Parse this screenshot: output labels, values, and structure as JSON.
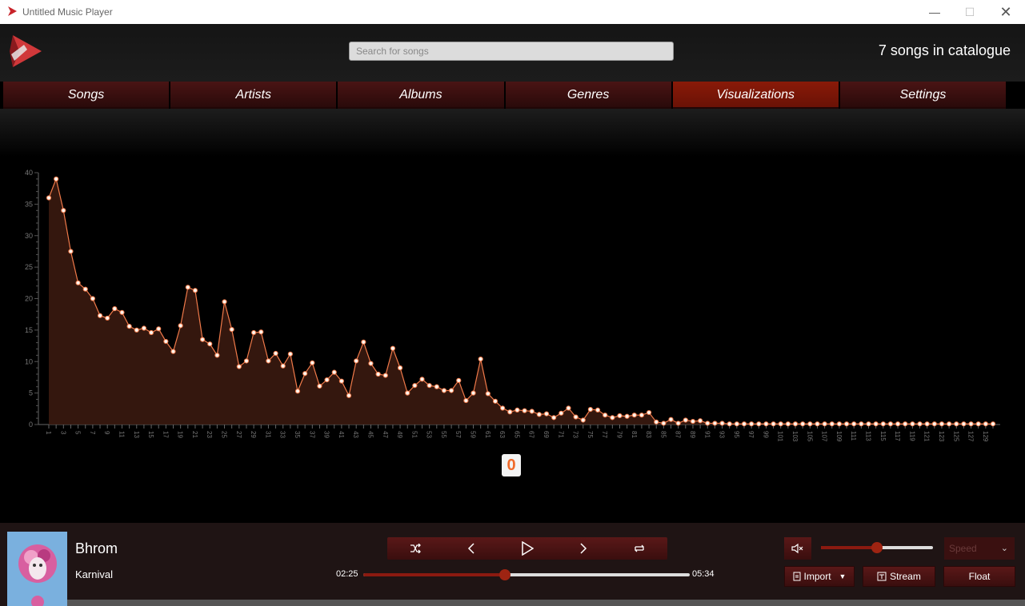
{
  "window": {
    "title": "Untitled Music Player"
  },
  "header": {
    "search_placeholder": "Search for songs",
    "catalogue_count": "7 songs in catalogue"
  },
  "tabs": [
    {
      "label": "Songs"
    },
    {
      "label": "Artists"
    },
    {
      "label": "Albums"
    },
    {
      "label": "Genres"
    },
    {
      "label": "Visualizations",
      "active": true
    },
    {
      "label": "Settings"
    }
  ],
  "colors": {
    "accent": "#f07a4a",
    "tab": "#4a1414",
    "tab_active": "#8a1a08",
    "bar": "#1f1414"
  },
  "chart_data": {
    "type": "area",
    "x": [
      1,
      2,
      3,
      4,
      5,
      6,
      7,
      8,
      9,
      10,
      11,
      12,
      13,
      14,
      15,
      16,
      17,
      18,
      19,
      20,
      21,
      22,
      23,
      24,
      25,
      26,
      27,
      28,
      29,
      30,
      31,
      32,
      33,
      34,
      35,
      36,
      37,
      38,
      39,
      40,
      41,
      42,
      43,
      44,
      45,
      46,
      47,
      48,
      49,
      50,
      51,
      52,
      53,
      54,
      55,
      56,
      57,
      58,
      59,
      60,
      61,
      62,
      63,
      64,
      65,
      66,
      67,
      68,
      69,
      70,
      71,
      72,
      73,
      74,
      75,
      76,
      77,
      78,
      79,
      80,
      81,
      82,
      83,
      84,
      85,
      86,
      87,
      88,
      89,
      90,
      91,
      92,
      93,
      94,
      95,
      96,
      97,
      98,
      99,
      100,
      101,
      102,
      103,
      104,
      105,
      106,
      107,
      108,
      109,
      110,
      111,
      112,
      113,
      114,
      115,
      116,
      117,
      118,
      119,
      120,
      121,
      122,
      123,
      124,
      125,
      126,
      127,
      128,
      129,
      130
    ],
    "values": [
      36,
      39,
      34,
      27.5,
      22.5,
      21.5,
      20,
      17.3,
      16.9,
      18.4,
      17.8,
      15.6,
      15,
      15.3,
      14.6,
      15.2,
      13.2,
      11.6,
      15.7,
      21.8,
      21.3,
      13.5,
      12.8,
      11,
      19.5,
      15.1,
      9.2,
      10.1,
      14.6,
      14.7,
      10.1,
      11.3,
      9.3,
      11.2,
      5.3,
      8.1,
      9.8,
      6.1,
      7.1,
      8.3,
      6.9,
      4.6,
      10.1,
      13.1,
      9.7,
      8,
      7.8,
      12.1,
      9,
      5,
      6.2,
      7.2,
      6.2,
      6,
      5.4,
      5.4,
      7,
      3.8,
      5,
      10.4,
      4.9,
      3.7,
      2.6,
      2,
      2.3,
      2.2,
      2.1,
      1.6,
      1.7,
      1.1,
      1.8,
      2.6,
      1.2,
      0.7,
      2.4,
      2.3,
      1.5,
      1.1,
      1.4,
      1.3,
      1.5,
      1.5,
      1.9,
      0.4,
      0.2,
      0.8,
      0.2,
      0.7,
      0.5,
      0.6,
      0.2,
      0.2,
      0.2,
      0.1,
      0.1,
      0.1,
      0.1,
      0.1,
      0.1,
      0.1,
      0.1,
      0.1,
      0.1,
      0.1,
      0.1,
      0.1,
      0.1,
      0.1,
      0.1,
      0.1,
      0.1,
      0.1,
      0.1,
      0.1,
      0.1,
      0.1,
      0.1,
      0.1,
      0.1,
      0.1,
      0.1,
      0.1,
      0.1,
      0.1,
      0.1,
      0.1,
      0.1,
      0.1,
      0.1,
      0.1
    ],
    "ylim": [
      0,
      40
    ],
    "yticks": [
      0,
      5,
      10,
      15,
      20,
      25,
      30,
      35,
      40
    ],
    "xtick_step": 2,
    "grid": false,
    "highlight_value": "0"
  },
  "player": {
    "title": "Bhrom",
    "artist": "Karnival",
    "elapsed": "02:25",
    "duration": "05:34",
    "progress": 0.434,
    "volume": 0.5,
    "speed_placeholder": "Speed",
    "import_label": "Import",
    "stream_label": "Stream",
    "float_label": "Float"
  },
  "icons": [
    "app-icon",
    "logo-icon",
    "shuffle-icon",
    "previous-icon",
    "play-icon",
    "next-icon",
    "repeat-icon",
    "mute-icon",
    "import-icon",
    "stream-icon",
    "chevron-down-icon",
    "minimize-icon",
    "maximize-icon",
    "close-icon"
  ]
}
